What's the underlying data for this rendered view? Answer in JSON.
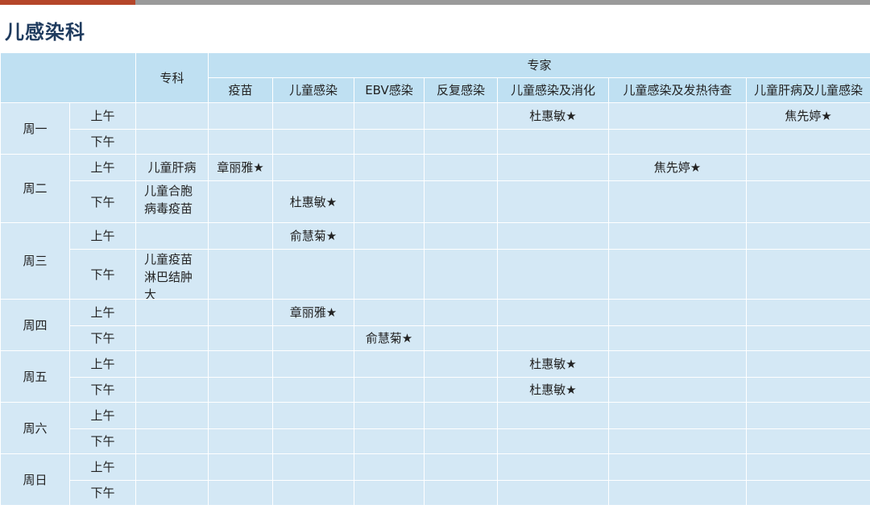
{
  "page_title": "儿感染科",
  "header": {
    "specialty": "专科",
    "experts": "专家",
    "columns": [
      "疫苗",
      "儿童感染",
      "EBV感染",
      "反复感染",
      "儿童感染及消化",
      "儿童感染及发热待查",
      "儿童肝病及儿童感染"
    ]
  },
  "rows": [
    {
      "day": "周一",
      "am": {
        "period": "上午",
        "specialty": "",
        "cells": [
          "",
          "",
          "",
          "",
          "杜惠敏★",
          "",
          "焦先婷★"
        ]
      },
      "pm": {
        "period": "下午",
        "specialty": "",
        "cells": [
          "",
          "",
          "",
          "",
          "",
          "",
          ""
        ]
      }
    },
    {
      "day": "周二",
      "am": {
        "period": "上午",
        "specialty": "儿童肝病",
        "cells": [
          "章丽雅★",
          "",
          "",
          "",
          "",
          "焦先婷★",
          ""
        ]
      },
      "pm": {
        "period": "下午",
        "specialty": "儿童合胞病毒疫苗",
        "cells": [
          "",
          "杜惠敏★",
          "",
          "",
          "",
          "",
          ""
        ]
      }
    },
    {
      "day": "周三",
      "am": {
        "period": "上午",
        "specialty": "",
        "cells": [
          "",
          "俞慧菊★",
          "",
          "",
          "",
          "",
          ""
        ]
      },
      "pm": {
        "period": "下午",
        "specialty": "儿童疫苗淋巴结肿大",
        "cells": [
          "",
          "",
          "",
          "",
          "",
          "",
          ""
        ]
      }
    },
    {
      "day": "周四",
      "am": {
        "period": "上午",
        "specialty": "",
        "cells": [
          "",
          "章丽雅★",
          "",
          "",
          "",
          "",
          ""
        ]
      },
      "pm": {
        "period": "下午",
        "specialty": "",
        "cells": [
          "",
          "",
          "俞慧菊★",
          "",
          "",
          "",
          ""
        ]
      }
    },
    {
      "day": "周五",
      "am": {
        "period": "上午",
        "specialty": "",
        "cells": [
          "",
          "",
          "",
          "",
          "杜惠敏★",
          "",
          ""
        ]
      },
      "pm": {
        "period": "下午",
        "specialty": "",
        "cells": [
          "",
          "",
          "",
          "",
          "杜惠敏★",
          "",
          ""
        ]
      }
    },
    {
      "day": "周六",
      "am": {
        "period": "上午",
        "specialty": "",
        "cells": [
          "",
          "",
          "",
          "",
          "",
          "",
          ""
        ]
      },
      "pm": {
        "period": "下午",
        "specialty": "",
        "cells": [
          "",
          "",
          "",
          "",
          "",
          "",
          ""
        ]
      }
    },
    {
      "day": "周日",
      "am": {
        "period": "上午",
        "specialty": "",
        "cells": [
          "",
          "",
          "",
          "",
          "",
          "",
          ""
        ]
      },
      "pm": {
        "period": "下午",
        "specialty": "",
        "cells": [
          "",
          "",
          "",
          "",
          "",
          "",
          ""
        ]
      }
    }
  ],
  "colors": {
    "header_bg": "#bfe0f2",
    "cell_bg": "#d4e8f5",
    "accent": "#b5462a",
    "title": "#1f3b5e"
  }
}
